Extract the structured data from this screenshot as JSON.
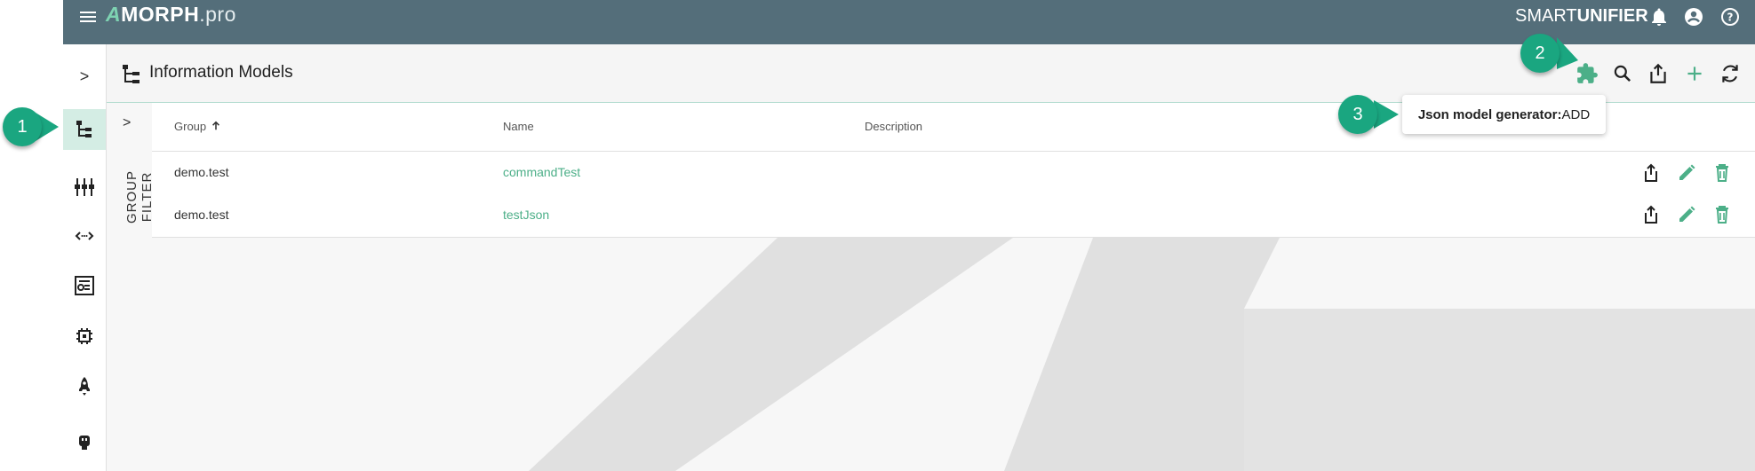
{
  "app": {
    "logo_part_a": "A",
    "logo_part_b": "MORPH",
    "logo_part_c": ".pro",
    "product_light": "SMART",
    "product_bold": "UNIFIER",
    "accent": "#4caf88",
    "topbar_color": "#546e7a"
  },
  "header": {
    "title": "Information Models"
  },
  "filter": {
    "label": "GROUP FILTER",
    "chevron": ">"
  },
  "table": {
    "columns": [
      "Group",
      "Name",
      "Description"
    ],
    "rows": [
      {
        "group": "demo.test",
        "name": "commandTest",
        "description": ""
      },
      {
        "group": "demo.test",
        "name": "testJson",
        "description": ""
      }
    ]
  },
  "tooltip": {
    "bold": "Json model generator:",
    "text": " ADD"
  },
  "callouts": [
    "1",
    "2",
    "3"
  ],
  "rail": {
    "expand_chevron": ">"
  }
}
